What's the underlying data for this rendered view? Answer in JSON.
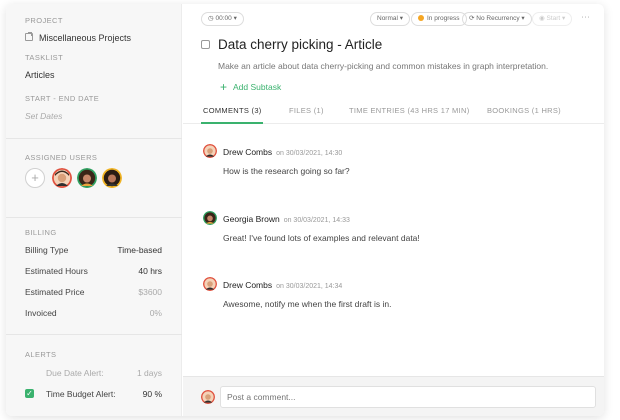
{
  "sidebar": {
    "project_label": "PROJECT",
    "project_name": "Miscellaneous Projects",
    "tasklist_label": "TASKLIST",
    "tasklist_name": "Articles",
    "dates_label": "START - END DATE",
    "dates_placeholder": "Set Dates",
    "assigned_label": "ASSIGNED USERS",
    "assigned_add": "+",
    "billing_label": "BILLING",
    "billing_rows": [
      {
        "label": "Billing Type",
        "value": "Time-based"
      },
      {
        "label": "Estimated Hours",
        "value": "40 hrs"
      },
      {
        "label": "Estimated Price",
        "value": "$3600"
      },
      {
        "label": "Invoiced",
        "value": "0%"
      }
    ],
    "alerts_label": "ALERTS",
    "alerts": [
      {
        "label": "Due Date Alert:",
        "value": "1 days",
        "checked": false
      },
      {
        "label": "Time Budget Alert:",
        "value": "90 %",
        "checked": true
      }
    ]
  },
  "topbar": {
    "timer": "00:00",
    "priority": "Normal",
    "status": "In progress",
    "recurrence": "No Recurrency",
    "more": "Start"
  },
  "task": {
    "title": "Data cherry picking - Article",
    "description": "Make an article about data cherry-picking and common mistakes in graph interpretation.",
    "add_subtask": "Add Subtask"
  },
  "tabs": [
    {
      "label": "COMMENTS (3)",
      "active": true
    },
    {
      "label": "FILES (1)",
      "active": false
    },
    {
      "label": "TIME ENTRIES (43 HRS 17 MIN)",
      "active": false
    },
    {
      "label": "BOOKINGS (1 HRS)",
      "active": false
    }
  ],
  "comments": [
    {
      "author": "Drew Combs",
      "meta": "on 30/03/2021, 14:30",
      "body": "How is the research going so far?"
    },
    {
      "author": "Georgia Brown",
      "meta": "on 30/03/2021, 14:33",
      "body": "Great! I've found lots of examples and relevant data!"
    },
    {
      "author": "Drew Combs",
      "meta": "on 30/03/2021, 14:34",
      "body": "Awesome, notify me when the first draft is in."
    }
  ],
  "footer": {
    "placeholder": "Post a comment..."
  },
  "colors": {
    "accent": "#3ab26e",
    "status_dot": "#f5a623"
  }
}
